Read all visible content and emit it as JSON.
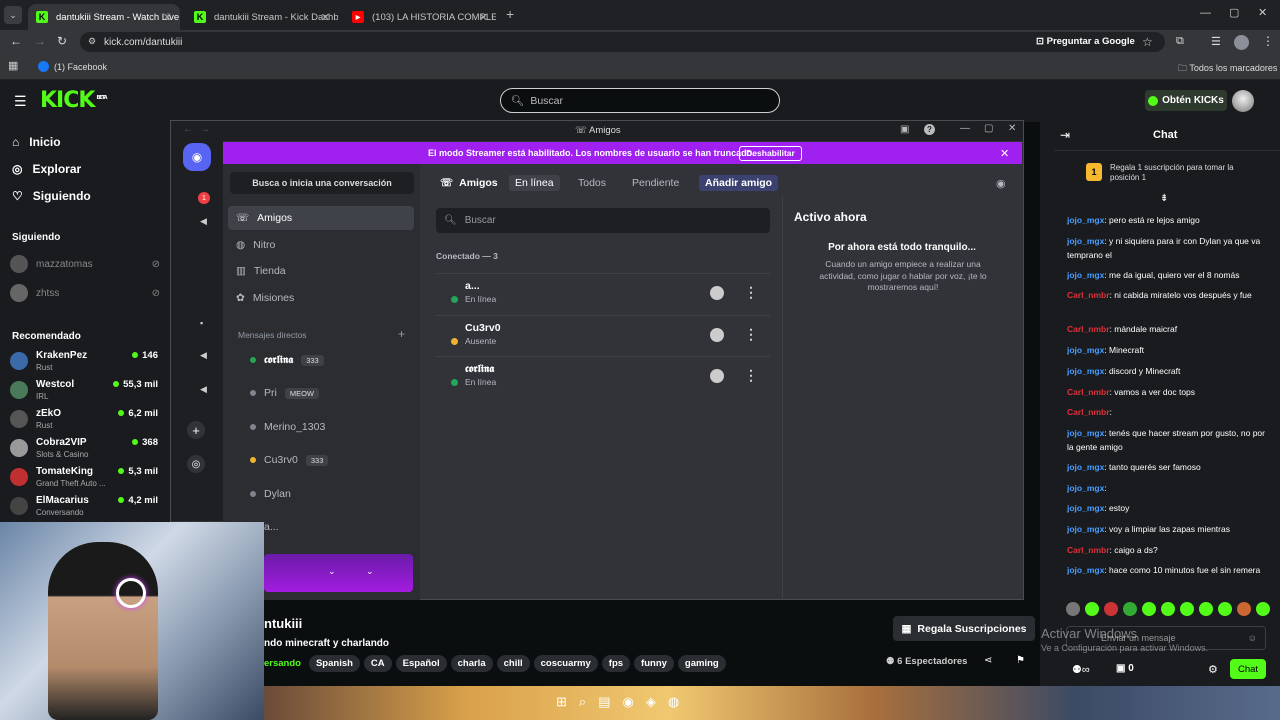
{
  "browser": {
    "tabs": [
      {
        "title": "dantukiii Stream - Watch Live o",
        "fav": "K",
        "color": "#53fc18"
      },
      {
        "title": "dantukiii Stream - Kick Dashbo",
        "fav": "K",
        "color": "#53fc18"
      },
      {
        "title": "(103) LA HISTORIA COMPLETA",
        "fav": "▶",
        "color": "#ff0000"
      }
    ],
    "url": "kick.com/dantukiii",
    "ask_google": "Preguntar a Google",
    "bookmark": "(1) Facebook",
    "all_bookmarks": "Todos los marcadores"
  },
  "kick": {
    "logo": "KICK",
    "beta": "BETA",
    "search_placeholder": "Buscar",
    "get_kicks": "Obtén KICKs",
    "nav": [
      "Inicio",
      "Explorar",
      "Siguiendo"
    ],
    "following_title": "Siguiendo",
    "following": [
      "mazzatomas",
      "zhtss"
    ],
    "recommended_title": "Recomendado",
    "recommended": [
      {
        "name": "KrakenPez",
        "cat": "Rust",
        "viewers": "146",
        "color": "#3b6aa8"
      },
      {
        "name": "Westcol",
        "cat": "IRL",
        "viewers": "55,3 mil",
        "color": "#4a7a5a"
      },
      {
        "name": "zEkO",
        "cat": "Rust",
        "viewers": "6,2 mil",
        "color": "#555"
      },
      {
        "name": "Cobra2VIP",
        "cat": "Slots & Casino",
        "viewers": "368",
        "color": "#999"
      },
      {
        "name": "TomateKing",
        "cat": "Grand Theft Auto ...",
        "viewers": "5,3 mil",
        "color": "#c03030"
      },
      {
        "name": "ElMacarius",
        "cat": "Conversando",
        "viewers": "4,2 mil",
        "color": "#444"
      }
    ],
    "stream_name": "ntukiii",
    "stream_title": "ndo minecraft y charlando",
    "category": "ersando",
    "tags": [
      "Spanish",
      "CA",
      "Español",
      "charla",
      "chill",
      "coscuarmy",
      "fps",
      "funny",
      "gaming"
    ],
    "gift_button": "Regala Suscripciones",
    "viewers": "6 Espectadores"
  },
  "discord": {
    "title": "Amigos",
    "banner": "El modo Streamer está habilitado. Los nombres de usuario se han truncado.",
    "disable": "Deshabilitar",
    "badge": "1",
    "dm_search": "Busca o inicia una conversación",
    "menu": [
      "Amigos",
      "Nitro",
      "Tienda",
      "Misiones"
    ],
    "dm_header": "Mensajes directos",
    "dms": [
      {
        "name": "𝖈𝖔𝖗𝖑𝖎𝖓𝖆",
        "tag": "333",
        "status": "#23a55a"
      },
      {
        "name": "Pri",
        "tag": "MEOW",
        "status": "#80848e"
      },
      {
        "name": "Merino_1303",
        "tag": "",
        "status": "#80848e"
      },
      {
        "name": "Cu3rv0",
        "tag": "333",
        "status": "#f0b232"
      },
      {
        "name": "Dylan",
        "tag": "",
        "status": "#80848e"
      },
      {
        "name": "a...",
        "tag": "",
        "status": ""
      }
    ],
    "tabs": {
      "friends": "Amigos",
      "online": "En línea",
      "all": "Todos",
      "pending": "Pendiente",
      "add": "Añadir amigo"
    },
    "search": "Buscar",
    "connected": "Conectado — 3",
    "friends": [
      {
        "name": "a...",
        "status": "En línea",
        "color": "#23a55a"
      },
      {
        "name": "Cu3rv0",
        "status": "Ausente",
        "color": "#f0b232"
      },
      {
        "name": "𝖈𝖔𝖗𝖑𝖎𝖓𝖆",
        "status": "En línea",
        "color": "#23a55a"
      }
    ],
    "active_title": "Activo ahora",
    "active_sub": "Por ahora está todo tranquilo...",
    "active_desc": "Cuando un amigo empiece a realizar una actividad, como jugar o hablar por voz, ¡te lo mostraremos aquí!"
  },
  "chat": {
    "title": "Chat",
    "gift_text": "Regala 1 suscripción para tomar la posición 1",
    "rank": "1",
    "messages": [
      {
        "user": "jojo_mgx",
        "color": "#4a9eff",
        "text": "pero está re lejos amigo",
        "lines": 1
      },
      {
        "user": "jojo_mgx",
        "color": "#4a9eff",
        "text": "y ni siquiera para ir con Dylan ya que va temprano el",
        "lines": 2
      },
      {
        "user": "jojo_mgx",
        "color": "#4a9eff",
        "text": "me da igual, quiero ver el 8 nomás",
        "lines": 1
      },
      {
        "user": "Carl_nmbr",
        "color": "#e0303a",
        "text": "ni cabida miratelo vos después y fue",
        "lines": 2
      },
      {
        "user": "Carl_nmbr",
        "color": "#e0303a",
        "text": "mándale maicraf",
        "lines": 1
      },
      {
        "user": "jojo_mgx",
        "color": "#4a9eff",
        "text": "Minecraft",
        "lines": 1
      },
      {
        "user": "jojo_mgx",
        "color": "#4a9eff",
        "text": "discord y Minecraft",
        "lines": 1
      },
      {
        "user": "Carl_nmbr",
        "color": "#e0303a",
        "text": "vamos a ver doc tops",
        "lines": 1
      },
      {
        "user": "Carl_nmbr",
        "color": "#e0303a",
        "text": "",
        "lines": 1
      },
      {
        "user": "jojo_mgx",
        "color": "#4a9eff",
        "text": "tenés que hacer stream por gusto, no por la gente amigo",
        "lines": 2
      },
      {
        "user": "jojo_mgx",
        "color": "#4a9eff",
        "text": "tanto querés ser famoso",
        "lines": 1
      },
      {
        "user": "jojo_mgx",
        "color": "#4a9eff",
        "text": "",
        "lines": 1
      },
      {
        "user": "jojo_mgx",
        "color": "#4a9eff",
        "text": "estoy",
        "lines": 1
      },
      {
        "user": "jojo_mgx",
        "color": "#4a9eff",
        "text": "voy a limpiar las zapas mientras",
        "lines": 1
      },
      {
        "user": "Carl_nmbr",
        "color": "#e0303a",
        "text": "caigo a ds?",
        "lines": 1
      },
      {
        "user": "jojo_mgx",
        "color": "#4a9eff",
        "text": "hace como 10 minutos fue el sin remera",
        "lines": 2
      }
    ],
    "input_placeholder": "Enviar un mensaje",
    "send": "Chat",
    "count": "0",
    "activate_title": "Activar Windows",
    "activate_sub": "Ve a Configuración para activar Windows."
  }
}
